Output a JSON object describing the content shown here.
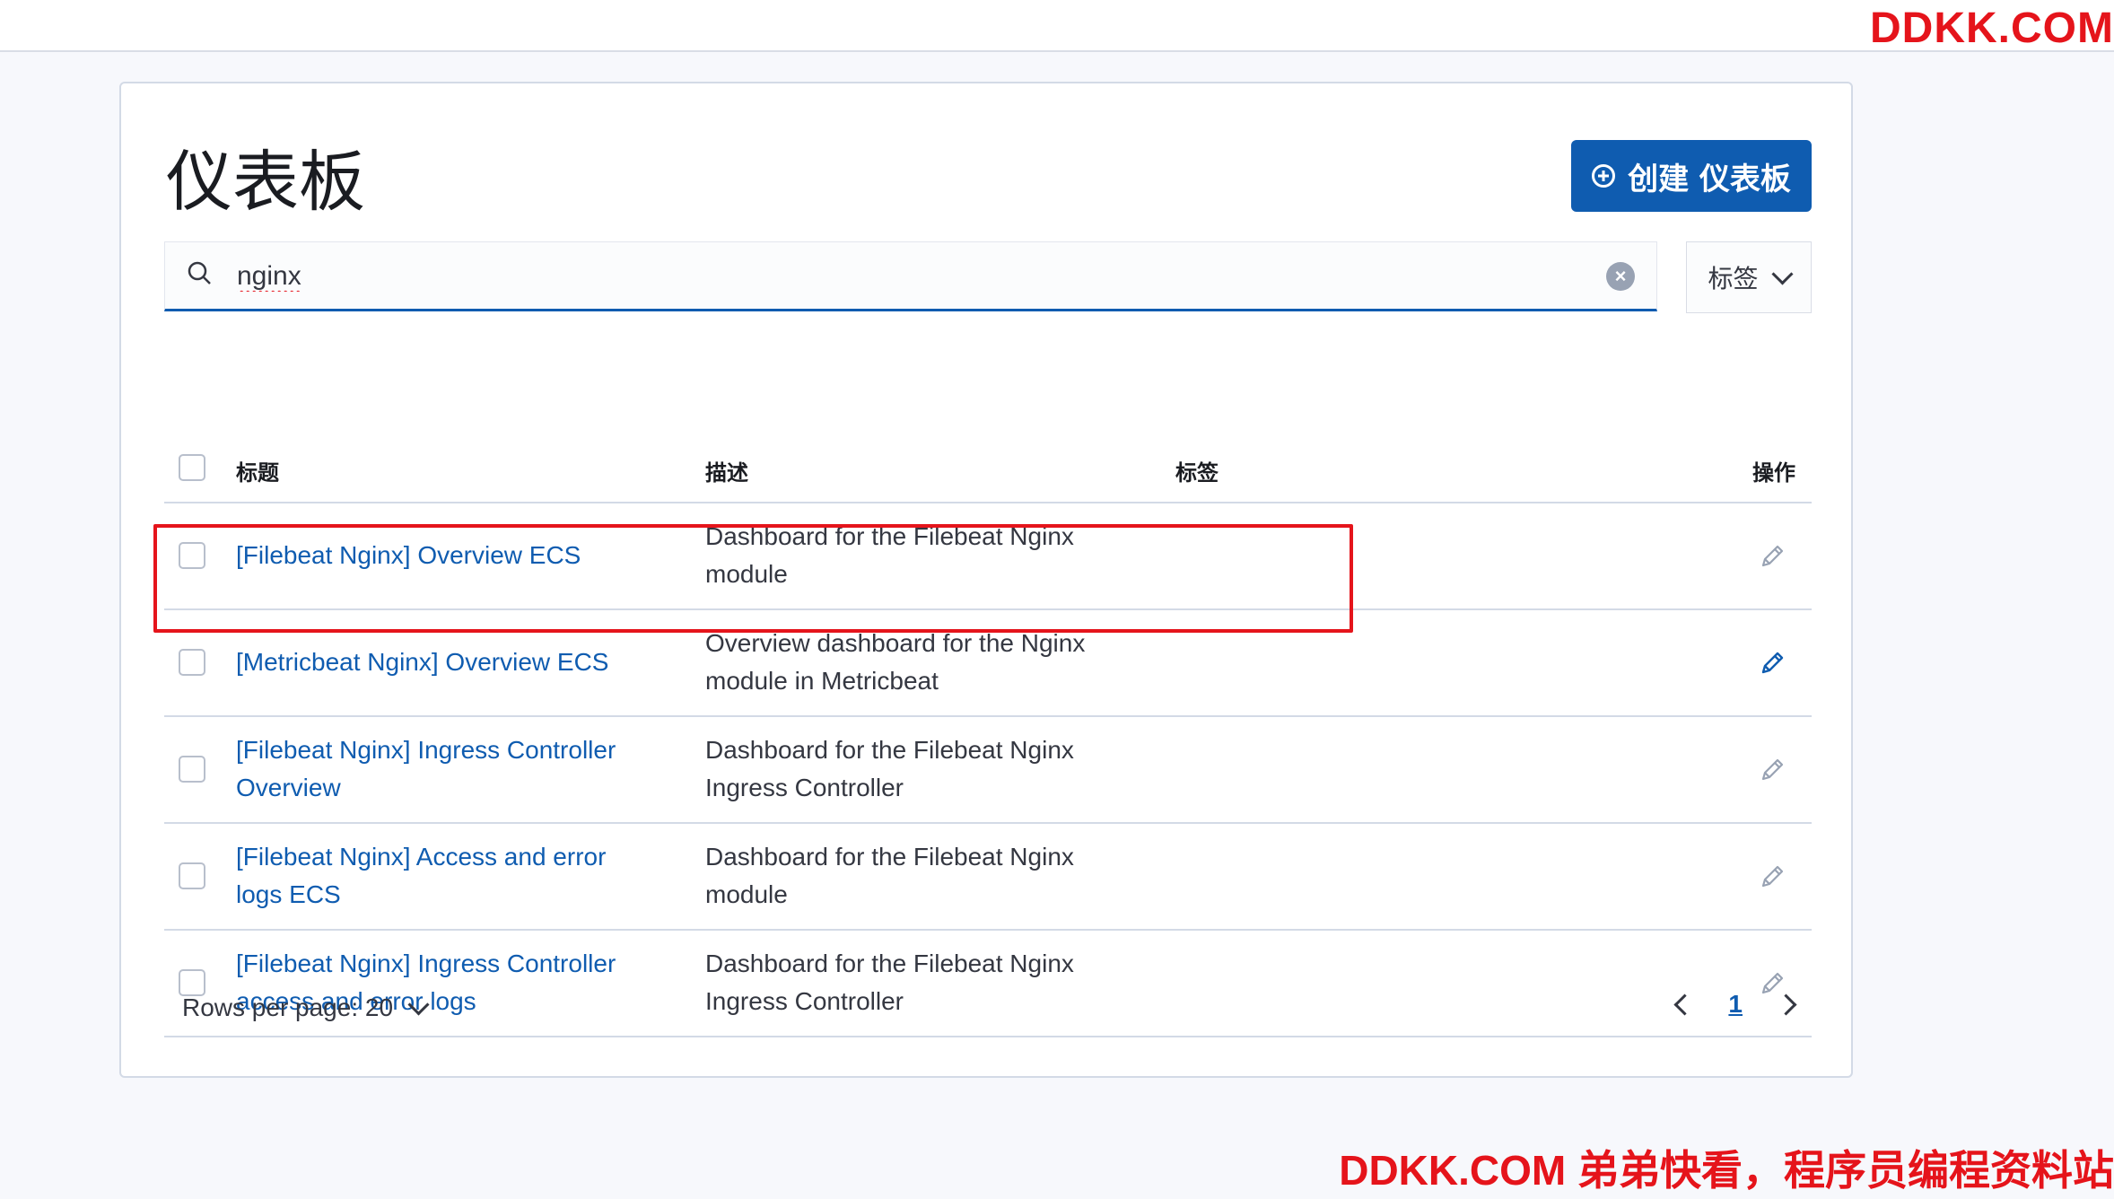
{
  "watermark": {
    "top": "DDKK.COM",
    "bottom": "DDKK.COM 弟弟快看，程序员编程资料站"
  },
  "page": {
    "title": "仪表板",
    "create_button": "创建 仪表板"
  },
  "search": {
    "value": "nginx",
    "placeholder": ""
  },
  "filter": {
    "tags_label": "标签"
  },
  "table": {
    "columns": {
      "title": "标题",
      "description": "描述",
      "tags": "标签",
      "actions": "操作"
    },
    "rows": [
      {
        "title": "[Filebeat Nginx] Overview ECS",
        "description": "Dashboard for the Filebeat Nginx module"
      },
      {
        "title": "[Metricbeat Nginx] Overview ECS",
        "description": "Overview dashboard for the Nginx module in Metricbeat"
      },
      {
        "title": "[Filebeat Nginx] Ingress Controller Overview",
        "description": "Dashboard for the Filebeat Nginx Ingress Controller"
      },
      {
        "title": "[Filebeat Nginx] Access and error logs ECS",
        "description": "Dashboard for the Filebeat Nginx module"
      },
      {
        "title": "[Filebeat Nginx] Ingress Controller access and error logs",
        "description": "Dashboard for the Filebeat Nginx Ingress Controller"
      }
    ]
  },
  "pagination": {
    "rows_per_page": "Rows per page: 20",
    "current_page": "1"
  },
  "colors": {
    "accent": "#0f5cb0",
    "highlight": "#e5141b"
  }
}
